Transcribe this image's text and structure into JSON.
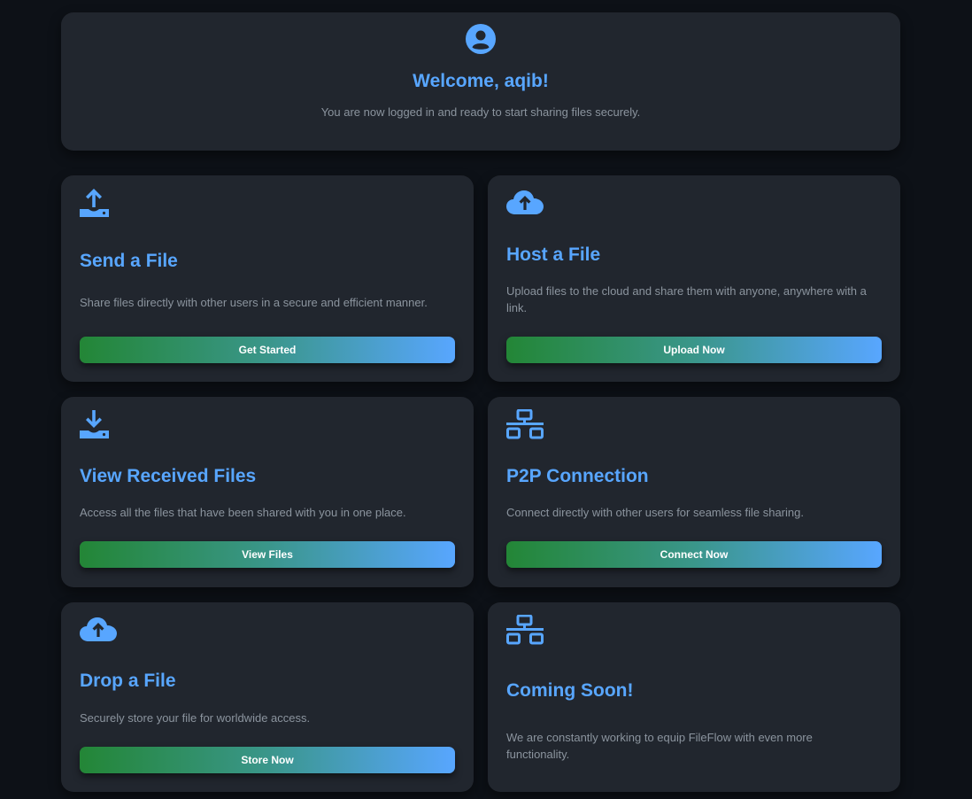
{
  "theme": {
    "accent": "#58a6ff",
    "background": "#0d1117",
    "card": "#21262e",
    "muted_text": "#8b949e",
    "button_gradient": [
      "#238636",
      "#58a6ff"
    ]
  },
  "welcome": {
    "icon": "user-circle-icon",
    "title": "Welcome, aqib!",
    "subtitle": "You are now logged in and ready to start sharing files securely."
  },
  "cards": [
    {
      "icon": "upload-tray-icon",
      "title": "Send a File",
      "description": "Share files directly with other users in a secure and efficient manner.",
      "button": "Get Started"
    },
    {
      "icon": "cloud-upload-icon",
      "title": "Host a File",
      "description": "Upload files to the cloud and share them with anyone, anywhere with a link.",
      "button": "Upload Now"
    },
    {
      "icon": "download-tray-icon",
      "title": "View Received Files",
      "description": "Access all the files that have been shared with you in one place.",
      "button": "View Files"
    },
    {
      "icon": "network-icon",
      "title": "P2P Connection",
      "description": "Connect directly with other users for seamless file sharing.",
      "button": "Connect Now"
    },
    {
      "icon": "cloud-upload-icon",
      "title": "Drop a File",
      "description": "Securely store your file for worldwide access.",
      "button": "Store Now"
    },
    {
      "icon": "network-icon",
      "title": "Coming Soon!",
      "description": "We are constantly working to equip FileFlow with even more functionality."
    }
  ]
}
